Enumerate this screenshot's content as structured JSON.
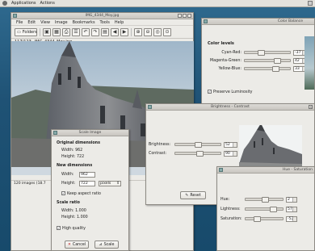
{
  "top_panel": {
    "menus": [
      "Applications",
      "Actions"
    ]
  },
  "viewer": {
    "title": "IMG_4344_Moy.jpg",
    "menu": [
      "File",
      "Edit",
      "View",
      "Image",
      "Bookmarks",
      "Tools",
      "Help"
    ],
    "folders_label": "Folders",
    "position": "117/123",
    "filename": "IMG_4344_Moy.jpg",
    "status_left": "120 images (18.7",
    "status_right": "6.4 K ."
  },
  "color_balance": {
    "title": "Color Balance",
    "section": "Color levels",
    "rows": [
      {
        "label": "Cyan-Red:",
        "value": "-37"
      },
      {
        "label": "Magenta-Green:",
        "value": "42"
      },
      {
        "label": "Yellow-Blue:",
        "value": "33"
      }
    ],
    "preserve": "Preserve Luminosity"
  },
  "brightness": {
    "title": "Brightness - Contrast",
    "rows": [
      {
        "label": "Brightness:",
        "value": "52"
      },
      {
        "label": "Contrast:",
        "value": "90"
      }
    ],
    "reset": "Reset"
  },
  "scale": {
    "title": "Scale Image",
    "orig_heading": "Original dimensions",
    "orig_width": "Width:   962",
    "orig_height": "Height:  722",
    "new_heading": "New dimensions",
    "width_label": "Width:",
    "width_value": "962",
    "height_label": "Height:",
    "height_value": "722",
    "unit": "pixels",
    "keep_ratio": "Keep aspect ratio",
    "ratio_heading": "Scale ratio",
    "ratio_width": "Width:   1.000",
    "ratio_height": "Height:  1.000",
    "high_quality": "High quality",
    "cancel": "Cancel",
    "scale_btn": "Scale"
  },
  "hue_sat": {
    "title": "Hue - Saturation",
    "rows": [
      {
        "label": "Hue:",
        "value": "2"
      },
      {
        "label": "Lightness:",
        "value": "57"
      },
      {
        "label": "Saturation:",
        "value": "-52"
      }
    ]
  },
  "desktop": {
    "label": "Photos"
  }
}
